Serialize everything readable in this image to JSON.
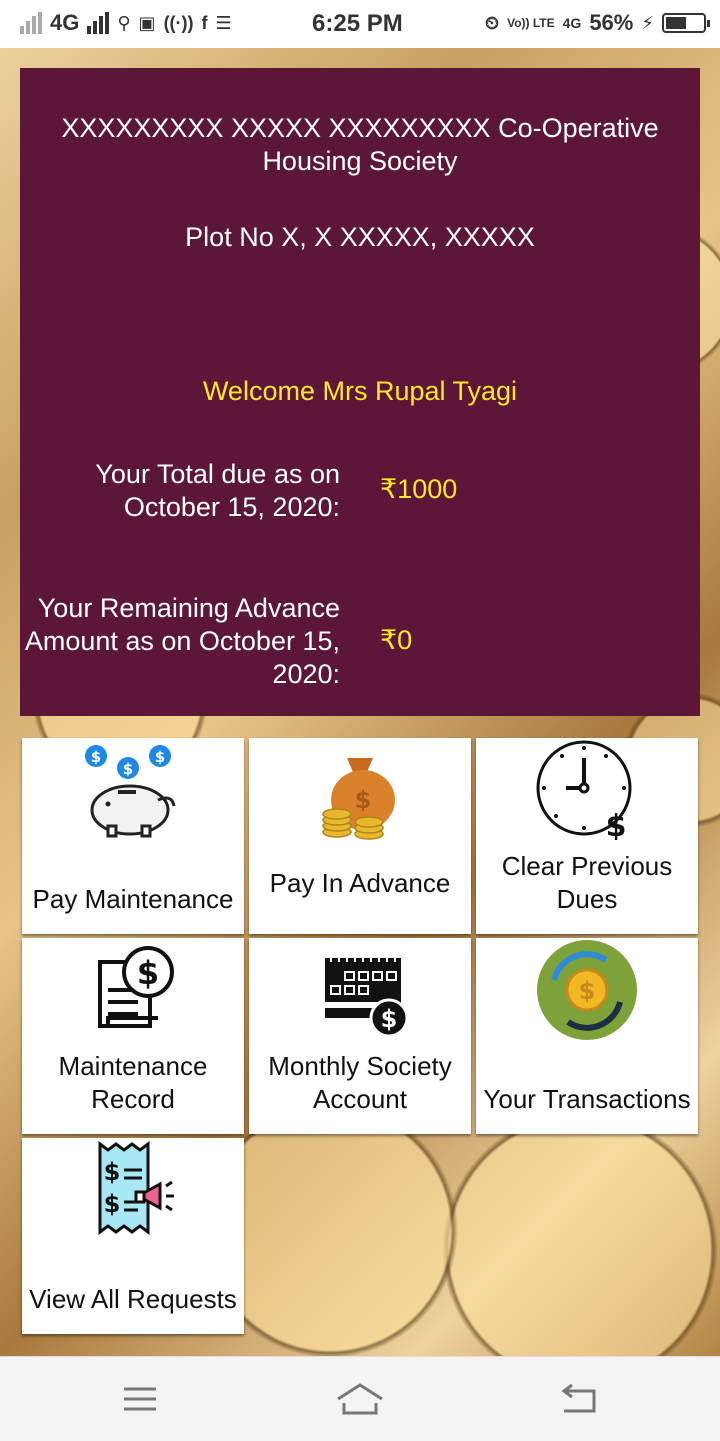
{
  "status_bar": {
    "network": "4G",
    "time": "6:25 PM",
    "volte": "Vo)) LTE",
    "network2": "4G",
    "battery": "56%",
    "battery_level": 0.56
  },
  "header": {
    "society_name": "XXXXXXXXX XXXXX XXXXXXXXX Co-Operative Housing Society",
    "address": "Plot No X, X XXXXX, XXXXX",
    "welcome": "Welcome Mrs Rupal Tyagi",
    "total_due_label": "Your Total due as on October 15, 2020:",
    "total_due_value": "₹1000",
    "advance_label": "Your Remaining Advance Amount as on October 15, 2020:",
    "advance_value": "₹0"
  },
  "tiles": [
    {
      "label": "Pay Maintenance",
      "icon": "piggy-bank-icon"
    },
    {
      "label": "Pay In Advance",
      "icon": "money-bag-icon"
    },
    {
      "label": "Clear Previous Dues",
      "icon": "clock-dollar-icon"
    },
    {
      "label": "Maintenance Record",
      "icon": "document-dollar-icon"
    },
    {
      "label": "Monthly Society Account",
      "icon": "calendar-dollar-icon"
    },
    {
      "label": "Your Transactions",
      "icon": "coin-exchange-icon"
    },
    {
      "label": "View All Requests",
      "icon": "receipt-megaphone-icon"
    }
  ],
  "colors": {
    "card_bg": "#5c1637",
    "highlight": "#ffe82a",
    "tile_bg": "#ffffff"
  },
  "nav_bar": {
    "items": [
      "menu-icon",
      "home-icon",
      "back-icon"
    ]
  }
}
